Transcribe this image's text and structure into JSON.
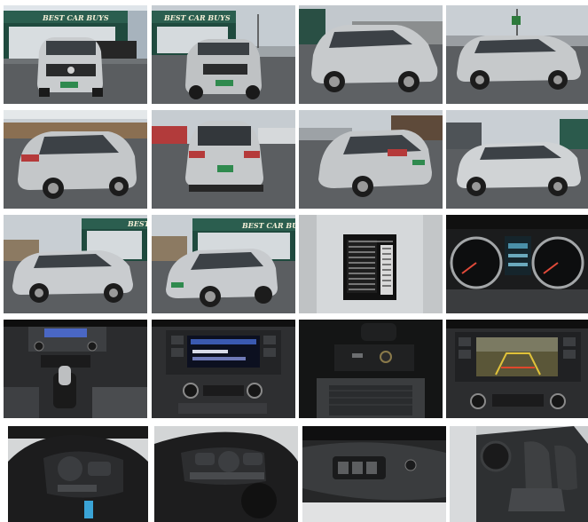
{
  "gallery": {
    "dealer_sign": "BEST CAR BUYS",
    "dealer_sign_partial": "BEST",
    "photos": [
      {
        "name": "front-view-photo"
      },
      {
        "name": "front-angle-photo"
      },
      {
        "name": "front-right-angle-photo"
      },
      {
        "name": "right-side-photo"
      },
      {
        "name": "rear-left-angle-photo"
      },
      {
        "name": "rear-view-photo"
      },
      {
        "name": "rear-right-angle-photo"
      },
      {
        "name": "right-profile-photo"
      },
      {
        "name": "left-profile-photo"
      },
      {
        "name": "left-front-angle-photo"
      },
      {
        "name": "door-jamb-label-photo"
      },
      {
        "name": "instrument-cluster-photo"
      },
      {
        "name": "center-console-photo"
      },
      {
        "name": "radio-display-photo"
      },
      {
        "name": "usb-port-photo"
      },
      {
        "name": "backup-camera-screen-photo"
      },
      {
        "name": "steering-wheel-left-controls-photo"
      },
      {
        "name": "steering-wheel-right-controls-photo"
      },
      {
        "name": "door-window-switches-photo"
      },
      {
        "name": "front-seats-photo"
      }
    ]
  }
}
